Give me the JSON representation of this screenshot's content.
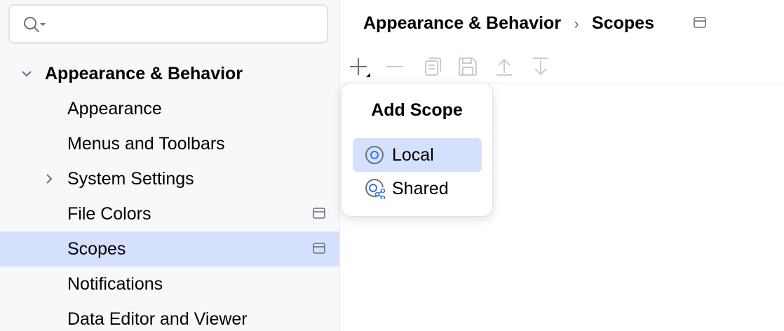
{
  "search": {
    "placeholder": "",
    "icon": "search-icon"
  },
  "sidebar": {
    "group": {
      "label": "Appearance & Behavior",
      "expanded": true
    },
    "items": [
      {
        "label": "Appearance"
      },
      {
        "label": "Menus and Toolbars"
      },
      {
        "label": "System Settings",
        "has_children": true
      },
      {
        "label": "File Colors",
        "project_level": true
      },
      {
        "label": "Scopes",
        "project_level": true,
        "selected": true
      },
      {
        "label": "Notifications"
      },
      {
        "label": "Data Editor and Viewer"
      }
    ]
  },
  "breadcrumb": {
    "parent": "Appearance & Behavior",
    "separator": "›",
    "current": "Scopes"
  },
  "toolbar": {
    "buttons": [
      "add-icon",
      "remove-icon",
      "copy-icon",
      "save-icon",
      "move-up-icon",
      "move-down-icon"
    ]
  },
  "popup": {
    "title": "Add Scope",
    "items": [
      {
        "label": "Local",
        "icon": "local-scope-icon",
        "selected": true
      },
      {
        "label": "Shared",
        "icon": "shared-scope-icon"
      }
    ]
  },
  "colors": {
    "selection": "#d5e0fc",
    "sidebar_bg": "#f7f8fa",
    "icon_gray": "#6c707e",
    "icon_disabled": "#c9ccd6",
    "accent_blue": "#3574f0"
  }
}
